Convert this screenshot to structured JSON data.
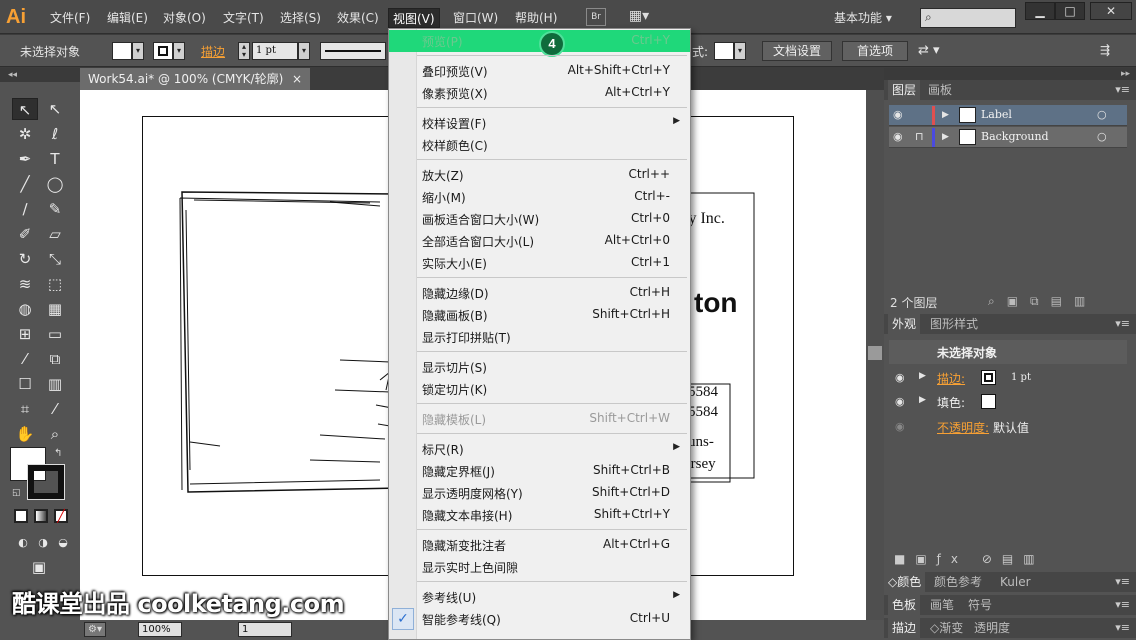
{
  "app": {
    "logo": "Ai"
  },
  "menubar": {
    "items": [
      "文件(F)",
      "编辑(E)",
      "对象(O)",
      "文字(T)",
      "选择(S)",
      "效果(C)",
      "视图(V)",
      "窗口(W)",
      "帮助(H)"
    ],
    "bridge_label": "Br",
    "workspace_label": "基本功能",
    "window_buttons": [
      "▁",
      "□",
      "✕"
    ]
  },
  "controlbar": {
    "selection_label": "未选择对象",
    "stroke_label": "描边",
    "stroke_value": "1 pt",
    "style_label": "式:",
    "doc_setup_button": "文档设置",
    "preferences_button": "首选项"
  },
  "document": {
    "tab_title": "Work54.ai* @ 100% (CMYK/轮廓)",
    "close_glyph": "×",
    "art_text_company": "ty Inc.",
    "art_text_big": "ton",
    "art_lines": [
      "5584",
      "5584",
      "uns-",
      "ersey"
    ]
  },
  "statusbar": {
    "zoom": "100%",
    "page": "1"
  },
  "view_menu": {
    "step_badge": "4",
    "check_glyph": "✓",
    "groups": [
      [
        {
          "label": "预览(P)",
          "shortcut": "Ctrl+Y",
          "highlight": true
        }
      ],
      [
        {
          "label": "叠印预览(V)",
          "shortcut": "Alt+Shift+Ctrl+Y"
        },
        {
          "label": "像素预览(X)",
          "shortcut": "Alt+Ctrl+Y"
        }
      ],
      [
        {
          "label": "校样设置(F)",
          "shortcut": "",
          "submenu": true
        },
        {
          "label": "校样颜色(C)",
          "shortcut": ""
        }
      ],
      [
        {
          "label": "放大(Z)",
          "shortcut": "Ctrl++"
        },
        {
          "label": "缩小(M)",
          "shortcut": "Ctrl+-"
        },
        {
          "label": "画板适合窗口大小(W)",
          "shortcut": "Ctrl+0"
        },
        {
          "label": "全部适合窗口大小(L)",
          "shortcut": "Alt+Ctrl+0"
        },
        {
          "label": "实际大小(E)",
          "shortcut": "Ctrl+1"
        }
      ],
      [
        {
          "label": "隐藏边缘(D)",
          "shortcut": "Ctrl+H"
        },
        {
          "label": "隐藏画板(B)",
          "shortcut": "Shift+Ctrl+H"
        },
        {
          "label": "显示打印拼贴(T)",
          "shortcut": ""
        }
      ],
      [
        {
          "label": "显示切片(S)",
          "shortcut": ""
        },
        {
          "label": "锁定切片(K)",
          "shortcut": ""
        }
      ],
      [
        {
          "label": "隐藏模板(L)",
          "shortcut": "Shift+Ctrl+W",
          "disabled": true
        }
      ],
      [
        {
          "label": "标尺(R)",
          "shortcut": "",
          "submenu": true
        },
        {
          "label": "隐藏定界框(J)",
          "shortcut": "Shift+Ctrl+B"
        },
        {
          "label": "显示透明度网格(Y)",
          "shortcut": "Shift+Ctrl+D"
        },
        {
          "label": "隐藏文本串接(H)",
          "shortcut": "Shift+Ctrl+Y"
        }
      ],
      [
        {
          "label": "隐藏渐变批注者",
          "shortcut": "Alt+Ctrl+G"
        },
        {
          "label": "显示实时上色间隙",
          "shortcut": ""
        }
      ],
      [
        {
          "label": "参考线(U)",
          "shortcut": "",
          "submenu": true
        },
        {
          "label": "智能参考线(Q)",
          "shortcut": "Ctrl+U",
          "checked": true
        }
      ]
    ]
  },
  "layers_panel": {
    "tabs": [
      "图层",
      "画板"
    ],
    "layers": [
      {
        "name": "Label",
        "color": "#e05050"
      },
      {
        "name": "Background",
        "color": "#4a4ae0"
      }
    ],
    "count_label": "2 个图层"
  },
  "appearance_panel": {
    "tabs": [
      "外观",
      "图形样式"
    ],
    "header": "未选择对象",
    "stroke_label": "描边:",
    "stroke_value": "1 pt",
    "fill_label": "填色:",
    "opacity_label": "不透明度:",
    "opacity_value": "默认值"
  },
  "color_panel": {
    "tabs": [
      "颜色",
      "颜色参考",
      "Kuler"
    ]
  },
  "swatch_panel": {
    "tabs": [
      "色板",
      "画笔",
      "符号"
    ]
  },
  "stroke_panel": {
    "tabs": [
      "描边",
      "渐变",
      "透明度"
    ]
  },
  "watermark": {
    "text": "酷课堂出品 coolketang.com"
  },
  "colors": {
    "accent_orange": "#f7a034",
    "highlight_green": "#1fd87a",
    "panel_bg": "#535353"
  }
}
